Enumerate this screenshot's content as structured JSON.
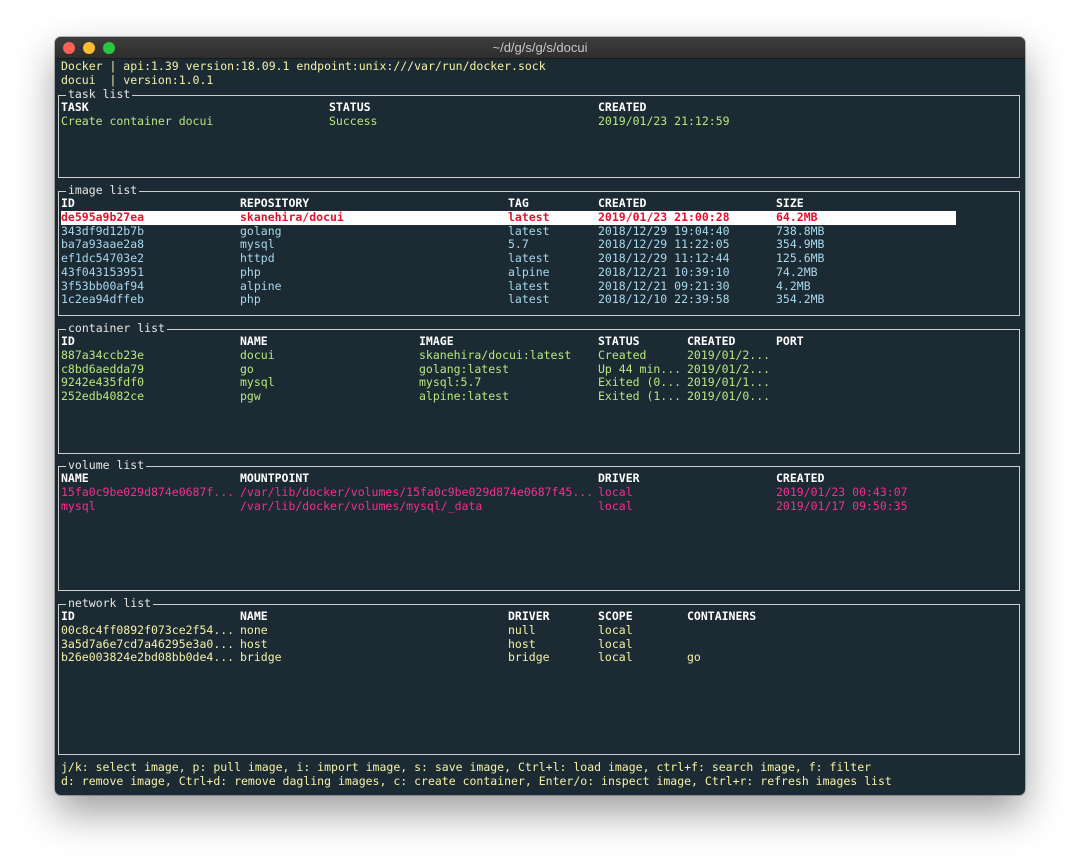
{
  "window": {
    "title": "~/d/g/s/g/s/docui"
  },
  "header": {
    "line1": "Docker | api:1.39 version:18.09.1 endpoint:unix:///var/run/docker.sock",
    "line2": "docui  | version:1.0.1"
  },
  "task_list": {
    "title": "task list",
    "columns": [
      "TASK",
      "STATUS",
      "CREATED"
    ],
    "rows": [
      [
        "Create container docui",
        "Success",
        "2019/01/23 21:12:59"
      ]
    ]
  },
  "image_list": {
    "title": "image list",
    "columns": [
      "ID",
      "REPOSITORY",
      "TAG",
      "CREATED",
      "SIZE"
    ],
    "selected_row": 0,
    "rows": [
      [
        "de595a9b27ea",
        "skanehira/docui",
        "latest",
        "2019/01/23 21:00:28",
        "64.2MB"
      ],
      [
        "343df9d12b7b",
        "golang",
        "latest",
        "2018/12/29 19:04:40",
        "738.8MB"
      ],
      [
        "ba7a93aae2a8",
        "mysql",
        "5.7",
        "2018/12/29 11:22:05",
        "354.9MB"
      ],
      [
        "ef1dc54703e2",
        "httpd",
        "latest",
        "2018/12/29 11:12:44",
        "125.6MB"
      ],
      [
        "43f043153951",
        "php",
        "alpine",
        "2018/12/21 10:39:10",
        "74.2MB"
      ],
      [
        "3f53bb00af94",
        "alpine",
        "latest",
        "2018/12/21 09:21:30",
        "4.2MB"
      ],
      [
        "1c2ea94dffeb",
        "php",
        "latest",
        "2018/12/10 22:39:58",
        "354.2MB"
      ]
    ]
  },
  "container_list": {
    "title": "container list",
    "columns": [
      "ID",
      "NAME",
      "IMAGE",
      "STATUS",
      "CREATED",
      "PORT"
    ],
    "rows": [
      [
        "887a34ccb23e",
        "docui",
        "skanehira/docui:latest",
        "Created",
        "2019/01/2...",
        ""
      ],
      [
        "c8bd6aedda79",
        "go",
        "golang:latest",
        "Up 44 min...",
        "2019/01/2...",
        ""
      ],
      [
        "9242e435fdf0",
        "mysql",
        "mysql:5.7",
        "Exited (0...",
        "2019/01/1...",
        ""
      ],
      [
        "252edb4082ce",
        "pgw",
        "alpine:latest",
        "Exited (1...",
        "2019/01/0...",
        ""
      ]
    ]
  },
  "volume_list": {
    "title": "volume list",
    "columns": [
      "NAME",
      "MOUNTPOINT",
      "DRIVER",
      "CREATED"
    ],
    "rows": [
      [
        "15fa0c9be029d874e0687f...",
        "/var/lib/docker/volumes/15fa0c9be029d874e0687f45...",
        "local",
        "2019/01/23 00:43:07"
      ],
      [
        "mysql",
        "/var/lib/docker/volumes/mysql/_data",
        "local",
        "2019/01/17 09:50:35"
      ]
    ]
  },
  "network_list": {
    "title": "network list",
    "columns": [
      "ID",
      "NAME",
      "DRIVER",
      "SCOPE",
      "CONTAINERS"
    ],
    "rows": [
      [
        "00c8c4ff0892f073ce2f54...",
        "none",
        "null",
        "local",
        ""
      ],
      [
        "3a5d7a6e7cd7a46295e3a0...",
        "host",
        "host",
        "local",
        ""
      ],
      [
        "b26e003824e2bd08bb0de4...",
        "bridge",
        "bridge",
        "local",
        "go"
      ]
    ]
  },
  "help": {
    "line1": "j/k: select image, p: pull image, i: import image, s: save image, Ctrl+l: load image, ctrl+f: search image, f: filter",
    "line2": "d: remove image, Ctrl+d: remove dagling images, c: create container, Enter/o: inspect image, Ctrl+r: refresh images list"
  },
  "colors": {
    "background": "#1c2a33",
    "header_text": "#f4f1a6",
    "task_text": "#b6e87d",
    "image_text": "#a8d8ec",
    "selected_row_text": "#e8102e",
    "container_text": "#b6e87d",
    "volume_text": "#f32f8f",
    "network_text": "#f4f1a6"
  }
}
